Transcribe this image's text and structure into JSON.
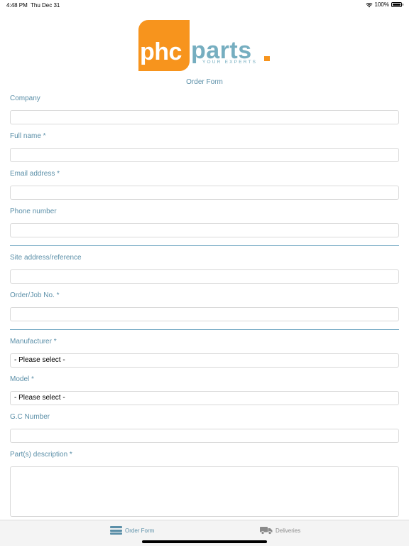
{
  "status_bar": {
    "time": "4:48 PM",
    "date": "Thu Dec 31",
    "battery": "100%",
    "battery_level": 1.0,
    "wifi_icon": "wifi-icon"
  },
  "logo": {
    "left_text": "phc",
    "right_text": "parts",
    "tagline": "YOUR EXPERTS",
    "colors": {
      "orange": "#f7941d",
      "teal": "#76aec0"
    }
  },
  "form": {
    "title": "Order Form",
    "fields": {
      "company": {
        "label": "Company",
        "value": ""
      },
      "full_name": {
        "label": "Full name *",
        "value": ""
      },
      "email": {
        "label": "Email address *",
        "value": ""
      },
      "phone": {
        "label": "Phone number",
        "value": ""
      },
      "site_address": {
        "label": "Site address/reference",
        "value": ""
      },
      "order_job": {
        "label": "Order/Job No. *",
        "value": ""
      },
      "manufacturer": {
        "label": "Manufacturer *",
        "selected": "- Please select -"
      },
      "model": {
        "label": "Model *",
        "selected": "- Please select -"
      },
      "gc_number": {
        "label": "G.C Number",
        "value": ""
      },
      "parts_description": {
        "label": "Part(s) description *",
        "value": ""
      }
    }
  },
  "tab_bar": {
    "items": [
      {
        "label": "Order Form",
        "icon": "menu-icon",
        "active": true
      },
      {
        "label": "Deliveries",
        "icon": "truck-icon",
        "active": false
      }
    ],
    "colors": {
      "active": "#5b8fa8",
      "inactive": "#8a8a8a"
    }
  }
}
